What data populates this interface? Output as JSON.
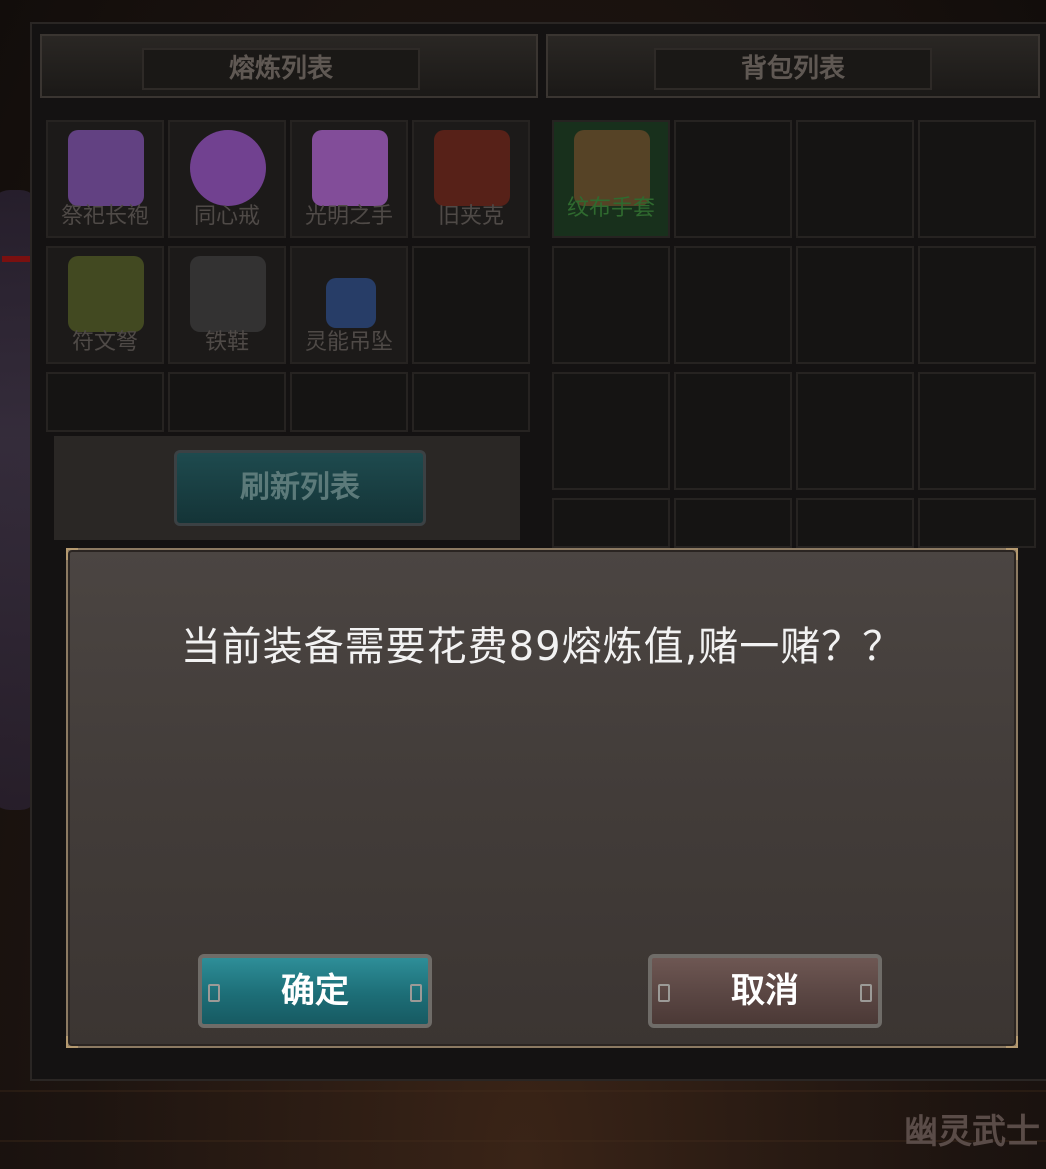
{
  "tabs": {
    "smelt_list": "熔炼列表",
    "bag_list": "背包列表"
  },
  "smelt_items": [
    {
      "name": "祭祀长袍",
      "icon": "purple-robe-icon",
      "color": "#7a4fa6"
    },
    {
      "name": "同心戒",
      "icon": "purple-ring-icon",
      "color": "#8d4fb8"
    },
    {
      "name": "光明之手",
      "icon": "purple-gloves-icon",
      "color": "#a45fc4"
    },
    {
      "name": "旧夹克",
      "icon": "red-jacket-icon",
      "color": "#6b2418"
    },
    {
      "name": "符文弩",
      "icon": "crossbow-icon",
      "color": "#4f5a24"
    },
    {
      "name": "铁鞋",
      "icon": "iron-boots-icon",
      "color": "#3b3b3b"
    },
    {
      "name": "灵能吊坠",
      "icon": "pendant-icon",
      "color": "#2b4a82"
    }
  ],
  "bag_items": [
    {
      "name": "纹布手套",
      "icon": "cloth-gloves-icon",
      "color": "#6b4a2a"
    }
  ],
  "refresh_button": "刷新列表",
  "dialog": {
    "message": "当前装备需要花费89熔炼值,赌一赌？？",
    "confirm": "确定",
    "cancel": "取消"
  },
  "watermark": "幽灵武士",
  "colors": {
    "confirm_button": "#1d6e77",
    "cancel_button": "#5a4643",
    "dialog_border": "#8c7a62"
  }
}
